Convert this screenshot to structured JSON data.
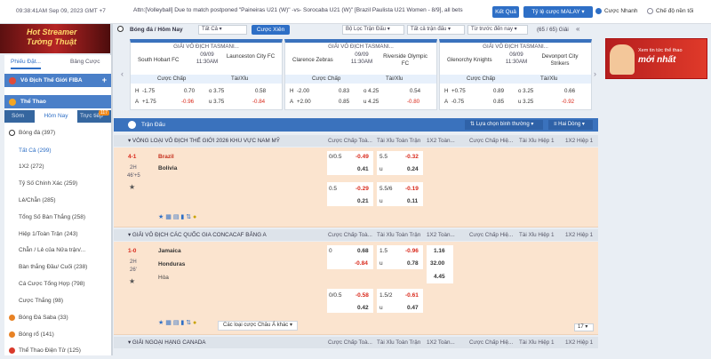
{
  "topbar": {
    "datetime": "09:38:41AM Sep 09, 2023 GMT +7",
    "marquee": "Attn:[Volleyball] Due to match postponed \"Paineiras U21 (W)\" -vs- Sorocaba U21 (W)\" [Brazil Paulista U21 Women - 8/9], all bets",
    "results_label": "Kết Quả",
    "odds_type": "Tỷ lệ cược MALAY",
    "quick_bet": "Cược Nhanh",
    "night_mode": "Chế độ nền tối"
  },
  "hot_banner": {
    "line1": "Hot Streamer",
    "line2": "Tường Thuật"
  },
  "sidebar": {
    "tab_slip": "Phiếu Đặt...",
    "tab_table": "Bảng Cược",
    "fiba": "Vô Địch Thế Giới FIBA",
    "sports": "Thể Thao",
    "tab_early": "Sớm",
    "tab_today": "Hôm Nay",
    "tab_live": "Trực tiếp",
    "live_count": "117",
    "items": [
      {
        "label": "Bóng đá (397)"
      },
      {
        "label": "Tất Cả (299)"
      },
      {
        "label": "1X2 (272)"
      },
      {
        "label": "Tỷ Số Chính Xác (259)"
      },
      {
        "label": "Lẻ/Chẵn (285)"
      },
      {
        "label": "Tổng Số Bàn Thắng (258)"
      },
      {
        "label": "Hiệp 1/Toàn Trận (243)"
      },
      {
        "label": "Chẵn / Lẻ của Nửa trận/..."
      },
      {
        "label": "Bàn thắng Đầu/ Cuối (238)"
      },
      {
        "label": "Cá Cược Tổng Hợp (798)"
      },
      {
        "label": "Cược Thắng (98)"
      },
      {
        "label": "Bóng Đá Saba (33)"
      },
      {
        "label": "Bóng rổ (141)"
      },
      {
        "label": "Thể Thao Điện Tử (125)"
      }
    ]
  },
  "filterbar": {
    "title": "Bóng đá / Hôm Nay",
    "all": "Tất Cả",
    "combo": "Cược Xiên",
    "league_filter": "Bộ Lọc Trận Đấu",
    "all_matches": "Tất cả trận đấu",
    "time_filter": "Từ trước đến nay",
    "count": "(65 / 65) Giải"
  },
  "cards": [
    {
      "league": "GIẢI VÔ ĐỊCH TASMANI...",
      "home": "South Hobart FC",
      "date": "09/09",
      "time": "11:30AM",
      "away": "Launceston City FC",
      "hdp_label": "Cược Chấp",
      "ou_label": "Tài/Xỉu",
      "rows": [
        {
          "side": "H",
          "line": "-1.75",
          "odds": "0.70",
          "ou": "o 3.75",
          "ou_odds": "0.58"
        },
        {
          "side": "A",
          "line": "+1.75",
          "odds": "-0.96",
          "ou": "u 3.75",
          "ou_odds": "-0.84"
        }
      ]
    },
    {
      "league": "GIẢI VÔ ĐỊCH TASMANI...",
      "home": "Clarence Zebras",
      "date": "09/09",
      "time": "11:30AM",
      "away": "Riverside Olympic FC",
      "hdp_label": "Cược Chấp",
      "ou_label": "Tài/Xỉu",
      "rows": [
        {
          "side": "H",
          "line": "-2.00",
          "odds": "0.83",
          "ou": "o 4.25",
          "ou_odds": "0.54"
        },
        {
          "side": "A",
          "line": "+2.00",
          "odds": "0.85",
          "ou": "u 4.25",
          "ou_odds": "-0.80"
        }
      ]
    },
    {
      "league": "GIẢI VÔ ĐỊCH TASMANI...",
      "home": "Glenorchy Knights",
      "date": "09/09",
      "time": "11:30AM",
      "away": "Devonport City Strikers",
      "hdp_label": "Cược Chấp",
      "ou_label": "Tài/Xỉu",
      "rows": [
        {
          "side": "H",
          "line": "+0.75",
          "odds": "0.89",
          "ou": "o 3.25",
          "ou_odds": "0.66"
        },
        {
          "side": "A",
          "line": "-0.75",
          "odds": "0.85",
          "ou": "u 3.25",
          "ou_odds": "-0.92"
        }
      ]
    }
  ],
  "ad": {
    "line1": "Xem tin tức thể thao",
    "line2": "mới nhất"
  },
  "main": {
    "title": "Trận Đấu",
    "sort": "Lựa chọn bình thường",
    "view": "Hai Dòng",
    "col_hdp": "Cược Chấp Toà...",
    "col_ou": "Tài Xỉu Toàn Trận",
    "col_1x2": "1X2 Toàn...",
    "col_hdp1": "Cược Chấp Hiệ...",
    "col_ou1": "Tài Xỉu Hiệp 1",
    "col_1x21": "1X2 Hiệp 1",
    "leagues": [
      {
        "name": "VÒNG LOẠI VÔ ĐỊCH THẾ GIỚI 2026 KHU VỰC NAM MỸ"
      },
      {
        "name": "GIẢI VÔ ĐỊCH CÁC QUỐC GIA CONCACAF BẢNG A"
      },
      {
        "name": "GIẢI NGOẠI HẠNG CANADA"
      }
    ],
    "match1": {
      "score": "4-1",
      "period": "2H",
      "minute": "46'+5",
      "home": "Brazil",
      "away": "Bolivia",
      "r1": {
        "hdp": "0/0.5",
        "hdp_odds": "-0.49",
        "ou": "5.5",
        "ou_odds": "-0.32"
      },
      "r2": {
        "hdp_odds": "0.41",
        "ou": "u",
        "ou_odds": "0.24"
      },
      "r3": {
        "hdp": "0.5",
        "hdp_odds": "-0.29",
        "ou": "5.5/6",
        "ou_odds": "-0.19"
      },
      "r4": {
        "hdp_odds": "0.21",
        "ou": "u",
        "ou_odds": "0.11"
      }
    },
    "match2": {
      "score": "1-0",
      "period": "2H",
      "minute": "26'",
      "home": "Jamaica",
      "away": "Honduras",
      "draw": "Hòa",
      "r1": {
        "hdp": "0",
        "hdp_odds": "0.68",
        "ou": "1.5",
        "ou_odds": "-0.96",
        "x12": "1.16"
      },
      "r2": {
        "hdp_odds": "-0.84",
        "ou": "u",
        "ou_odds": "0.78",
        "x12": "32.00"
      },
      "r2b": {
        "x12": "4.45"
      },
      "r3": {
        "hdp": "0/0.5",
        "hdp_odds": "-0.58",
        "ou": "1.5/2",
        "ou_odds": "-0.61"
      },
      "r4": {
        "hdp_odds": "0.42",
        "ou": "u",
        "ou_odds": "0.47"
      }
    },
    "more": "Các loại cược Châu Á khác",
    "pager": "17"
  }
}
